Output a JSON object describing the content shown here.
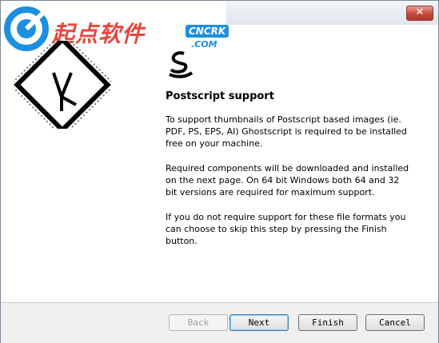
{
  "window": {
    "close_glyph": "✕"
  },
  "watermark": {
    "brand_text": "起点软件",
    "badge": "CNCRK",
    "domain": ".COM"
  },
  "page": {
    "heading": "Postscript support",
    "paragraphs": [
      "To support thumbnails of Postscript based images (ie. PDF, PS, EPS, AI) Ghostscript is required to be installed free on your machine.",
      "Required components will be downloaded and installed on the next page. On 64 bit Windows both 64 and 32 bit versions are required for maximum support.",
      "If you do not require support for these file formats you can choose to skip this step by pressing the Finish button."
    ]
  },
  "buttons": {
    "back": "Back",
    "next": "Next",
    "finish": "Finish",
    "cancel": "Cancel"
  },
  "colors": {
    "accent": "#1d8fe0",
    "watermark_red": "#e8463b"
  }
}
